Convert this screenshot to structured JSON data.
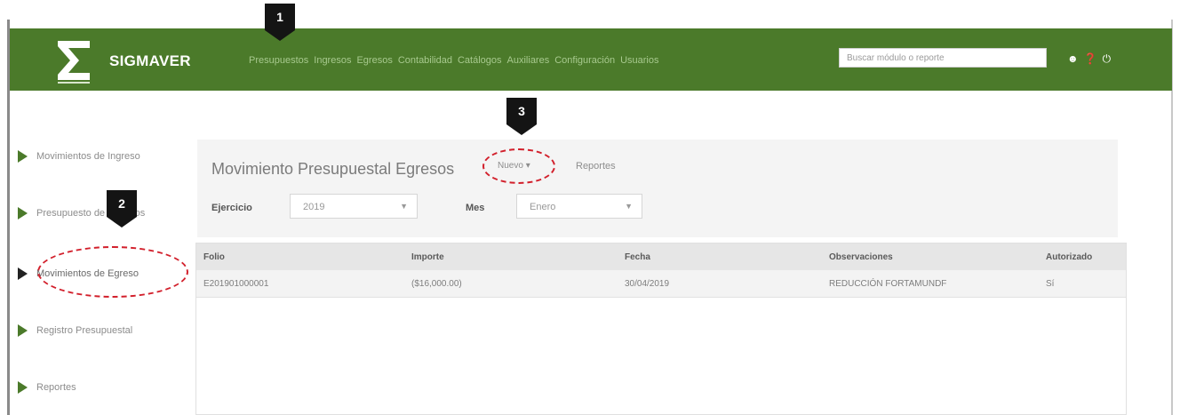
{
  "app": {
    "brand": "SIGMAVER"
  },
  "nav": {
    "items": [
      "Presupuestos",
      "Ingresos",
      "Egresos",
      "Contabilidad",
      "Catálogos",
      "Auxiliares",
      "Configuración",
      "Usuarios"
    ]
  },
  "search": {
    "placeholder": "Buscar módulo o reporte"
  },
  "header_icons": [
    "user-icon",
    "help-icon",
    "power-icon"
  ],
  "sidebar": {
    "items": [
      {
        "label": "Movimientos de Ingreso"
      },
      {
        "label": "Presupuesto de Ingresos"
      },
      {
        "label": "Movimientos de Egreso"
      },
      {
        "label": "Registro Presupuestal"
      },
      {
        "label": "Reportes"
      }
    ]
  },
  "page": {
    "title": "Movimiento Presupuestal Egresos",
    "nuevo": "Nuevo",
    "reportes": "Reportes"
  },
  "filters": {
    "ejercicio_label": "Ejercicio",
    "ejercicio_value": "2019",
    "mes_label": "Mes",
    "mes_value": "Enero"
  },
  "table": {
    "headers": [
      "Folio",
      "Importe",
      "Fecha",
      "Observaciones",
      "Autorizado"
    ],
    "rows": [
      [
        "E201901000001",
        "($16,000.00)",
        "30/04/2019",
        "REDUCCIÓN FORTAMUNDF",
        "Sí"
      ]
    ]
  },
  "callouts": [
    "1",
    "2",
    "3"
  ],
  "colors": {
    "topbar": "#4b7a2a",
    "callout": "#141414",
    "highlight": "#d21f2b"
  }
}
